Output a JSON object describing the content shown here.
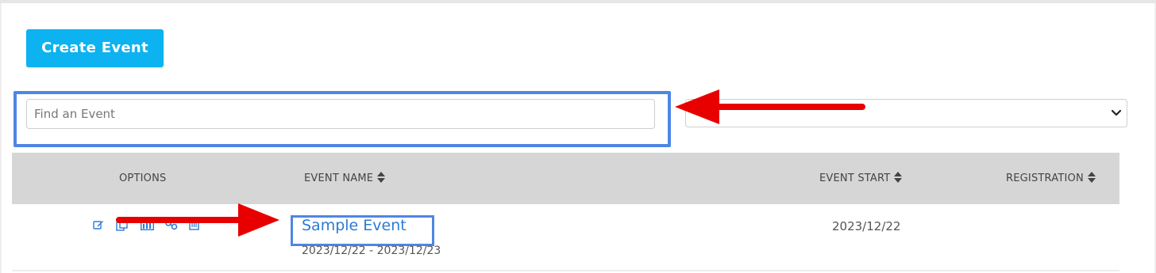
{
  "toolbar": {
    "create_label": "Create Event"
  },
  "search": {
    "placeholder": "Find an Event",
    "value": ""
  },
  "filter": {
    "selected": ""
  },
  "table": {
    "headers": {
      "options": "OPTIONS",
      "event_name": "EVENT NAME",
      "event_start": "EVENT START",
      "registration": "REGISTRATION"
    },
    "rows": [
      {
        "name": "Sample Event",
        "dates": "2023/12/22 - 2023/12/23",
        "start": "2023/12/22",
        "registration": "",
        "options": [
          "edit-icon",
          "copy-icon",
          "report-icon",
          "link-icon",
          "delete-icon"
        ]
      }
    ]
  },
  "colors": {
    "accent": "#0db2f0",
    "highlight": "#4e86e4",
    "annotation_arrow": "#e80000",
    "link": "#2c7ad6",
    "header_bg": "#d6d6d6"
  }
}
